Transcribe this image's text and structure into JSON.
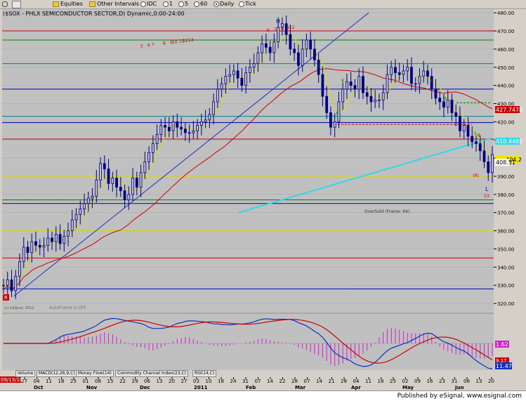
{
  "toolbar": {
    "equities": "Equities",
    "other_intervals": "Other Intervals",
    "intervals": [
      "IDC",
      "1",
      "5",
      "60",
      "Daily",
      "Tick"
    ]
  },
  "chart_title": "($SOX - PHLX SEMICONDUCTOR SECTOR,D) Dynamic,0:00-24:00",
  "labels": {
    "overbold": "OverSold (Frame: 64)",
    "autoframe": "AutoFrame is OFF",
    "esignal_small": "(c) eSignal, 2011",
    "date_badge": "09/15/10"
  },
  "price_tags": {
    "red": "427.7478",
    "cyan": "410.4482",
    "yellow": "404.2",
    "white": "408.51",
    "macd_magenta": "1.62",
    "macd_red": "9.17",
    "macd_blue": "11.47"
  },
  "pattern_labels": {
    "h": "H",
    "l": "L",
    "r": "(R)",
    "n23": "23"
  },
  "indicator_tabs": [
    "Volume",
    "MACD(12,26,9,C)",
    "Money Flow(14)",
    "Commodity Channel Index(23,C)",
    "RSI(14,C)"
  ],
  "x_axis": {
    "days": [
      "27",
      "04",
      "11",
      "18",
      "25",
      "01",
      "08",
      "15",
      "22",
      "29",
      "06",
      "13",
      "20",
      "27",
      "03",
      "10",
      "18",
      "24",
      "31",
      "07",
      "14",
      "22",
      "28",
      "07",
      "14",
      "21",
      "28",
      "04",
      "11",
      "18",
      "25",
      "02",
      "09",
      "16",
      "23",
      "31",
      "06",
      "13",
      "20"
    ],
    "months": [
      "Oct",
      "Nov",
      "Dec",
      "2011",
      "Feb",
      "Mar",
      "Apr",
      "May",
      "Jun"
    ]
  },
  "footer": {
    "publisher": "Published by eSignal, www.esignal.com"
  },
  "colors": {
    "plot_bg": "#c0c0c0",
    "price_bar": "#000080",
    "grid": "#a8a8a8",
    "ma_red": "#cc0000",
    "ma_yellow": "#d8d800",
    "trend_blue": "#2030c0",
    "trend_cyan": "#30d8e8",
    "macd_magenta": "#d020d0"
  },
  "chart_data": {
    "type": "candlestick",
    "title": "($SOX - PHLX SEMICONDUCTOR SECTOR,D) Dynamic,0:00-24:00",
    "y_axis": {
      "min": 315,
      "max": 482,
      "ticks": [
        320,
        330,
        340,
        350,
        360,
        370,
        380,
        390,
        400,
        410,
        420,
        430,
        440,
        450,
        460,
        470,
        480
      ]
    },
    "close": [
      330,
      333,
      327,
      335,
      343,
      351,
      348,
      354,
      352,
      351,
      352,
      356,
      354,
      358,
      353,
      357,
      360,
      366,
      369,
      372,
      375,
      378,
      379,
      388,
      397,
      394,
      386,
      389,
      384,
      382,
      377,
      380,
      389,
      384,
      392,
      398,
      403,
      408,
      413,
      418,
      417,
      415,
      420,
      417,
      416,
      414,
      414,
      415,
      418,
      420,
      421,
      424,
      431,
      438,
      441,
      445,
      446,
      448,
      444,
      440,
      447,
      450,
      452,
      458,
      463,
      461,
      458,
      464,
      472,
      474,
      468,
      460,
      458,
      451,
      460,
      465,
      460,
      454,
      446,
      434,
      425,
      417,
      420,
      431,
      438,
      442,
      440,
      438,
      445,
      436,
      434,
      431,
      432,
      432,
      436,
      446,
      450,
      447,
      446,
      448,
      450,
      441,
      441,
      445,
      448,
      445,
      438,
      433,
      431,
      428,
      432,
      425,
      423,
      415,
      418,
      412,
      409,
      408,
      404,
      398,
      392,
      402
    ],
    "horizontal_levels": [
      {
        "value": 470,
        "color": "#cc0000"
      },
      {
        "value": 465,
        "color": "#008000"
      },
      {
        "value": 452,
        "color": "#008080"
      },
      {
        "value": 438,
        "color": "#0000c0"
      },
      {
        "value": 423,
        "color": "#008080"
      },
      {
        "value": 419.5,
        "color": "#0000c0"
      },
      {
        "value": 410.5,
        "color": "#cc0000"
      },
      {
        "value": 390,
        "color": "#d8d800"
      },
      {
        "value": 377,
        "color": "#008000"
      },
      {
        "value": 375,
        "color": "#0000c0"
      },
      {
        "value": 360,
        "color": "#d8d800"
      },
      {
        "value": 345,
        "color": "#cc0000"
      },
      {
        "value": 328,
        "color": "#0000c0"
      }
    ],
    "annotations": [
      "H",
      "L",
      "(R)",
      "OverSold (Frame: 64)"
    ]
  }
}
